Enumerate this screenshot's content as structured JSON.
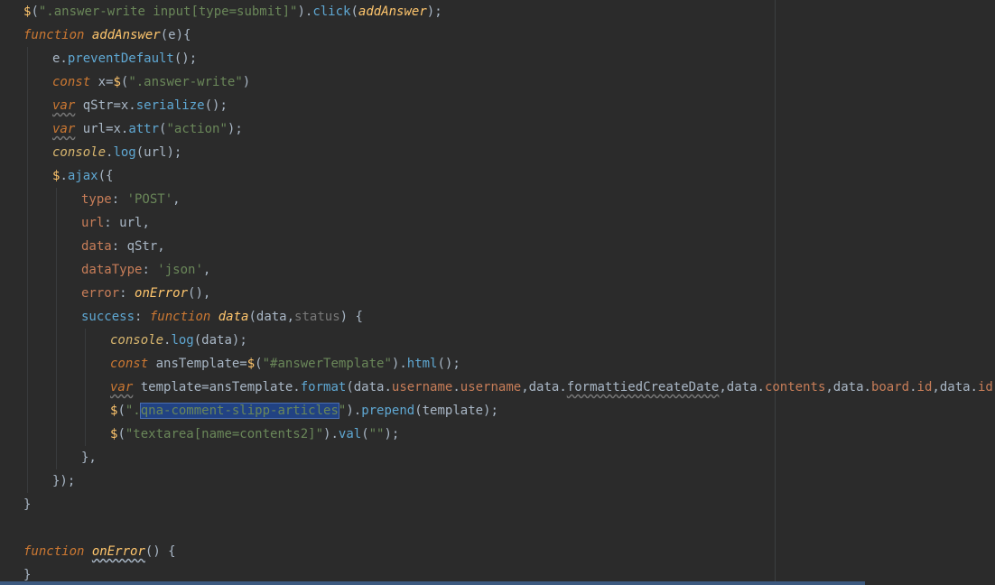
{
  "editor": {
    "lines": [
      {
        "indent": 0,
        "tokens": [
          {
            "c": "t-dollar",
            "t": "$"
          },
          {
            "c": "t-plain",
            "t": "("
          },
          {
            "c": "t-str",
            "t": "\".answer-write input[type=submit]\""
          },
          {
            "c": "t-plain",
            "t": ")."
          },
          {
            "c": "t-method",
            "t": "click"
          },
          {
            "c": "t-plain",
            "t": "("
          },
          {
            "c": "t-fn",
            "t": "addAnswer"
          },
          {
            "c": "t-plain",
            "t": ");"
          }
        ]
      },
      {
        "indent": 0,
        "tokens": [
          {
            "c": "t-kw",
            "t": "function"
          },
          {
            "c": "t-plain",
            "t": " "
          },
          {
            "c": "t-fn",
            "t": "addAnswer"
          },
          {
            "c": "t-plain",
            "t": "(e){"
          }
        ]
      },
      {
        "indent": 1,
        "tokens": [
          {
            "c": "t-plain",
            "t": "e."
          },
          {
            "c": "t-method",
            "t": "preventDefault"
          },
          {
            "c": "t-plain",
            "t": "();"
          }
        ]
      },
      {
        "indent": 1,
        "tokens": [
          {
            "c": "t-kw",
            "t": "const"
          },
          {
            "c": "t-plain",
            "t": " x="
          },
          {
            "c": "t-dollar",
            "t": "$"
          },
          {
            "c": "t-plain",
            "t": "("
          },
          {
            "c": "t-str",
            "t": "\".answer-write\""
          },
          {
            "c": "t-plain",
            "t": ")"
          }
        ]
      },
      {
        "indent": 1,
        "tokens": [
          {
            "c": "t-kw t-wavy",
            "t": "var"
          },
          {
            "c": "t-plain",
            "t": " qStr=x."
          },
          {
            "c": "t-method",
            "t": "serialize"
          },
          {
            "c": "t-plain",
            "t": "();"
          }
        ]
      },
      {
        "indent": 1,
        "tokens": [
          {
            "c": "t-kw t-wavy",
            "t": "var"
          },
          {
            "c": "t-plain",
            "t": " url=x."
          },
          {
            "c": "t-method",
            "t": "attr"
          },
          {
            "c": "t-plain",
            "t": "("
          },
          {
            "c": "t-str",
            "t": "\"action\""
          },
          {
            "c": "t-plain",
            "t": ");"
          }
        ]
      },
      {
        "indent": 1,
        "tokens": [
          {
            "c": "t-console",
            "t": "console"
          },
          {
            "c": "t-plain",
            "t": "."
          },
          {
            "c": "t-method",
            "t": "log"
          },
          {
            "c": "t-plain",
            "t": "(url);"
          }
        ]
      },
      {
        "indent": 1,
        "tokens": [
          {
            "c": "t-dollar",
            "t": "$"
          },
          {
            "c": "t-plain",
            "t": "."
          },
          {
            "c": "t-method",
            "t": "ajax"
          },
          {
            "c": "t-plain",
            "t": "({"
          }
        ]
      },
      {
        "indent": 2,
        "tokens": [
          {
            "c": "t-key",
            "t": "type"
          },
          {
            "c": "t-plain",
            "t": ": "
          },
          {
            "c": "t-str",
            "t": "'POST'"
          },
          {
            "c": "t-plain",
            "t": ","
          }
        ]
      },
      {
        "indent": 2,
        "tokens": [
          {
            "c": "t-key",
            "t": "url"
          },
          {
            "c": "t-plain",
            "t": ": url,"
          }
        ]
      },
      {
        "indent": 2,
        "tokens": [
          {
            "c": "t-key",
            "t": "data"
          },
          {
            "c": "t-plain",
            "t": ": qStr,"
          }
        ]
      },
      {
        "indent": 2,
        "tokens": [
          {
            "c": "t-key",
            "t": "dataType"
          },
          {
            "c": "t-plain",
            "t": ": "
          },
          {
            "c": "t-str",
            "t": "'json'"
          },
          {
            "c": "t-plain",
            "t": ","
          }
        ]
      },
      {
        "indent": 2,
        "tokens": [
          {
            "c": "t-key",
            "t": "error"
          },
          {
            "c": "t-plain",
            "t": ": "
          },
          {
            "c": "t-fn",
            "t": "onError"
          },
          {
            "c": "t-plain",
            "t": "(),"
          }
        ]
      },
      {
        "indent": 2,
        "tokens": [
          {
            "c": "t-method",
            "t": "success"
          },
          {
            "c": "t-plain",
            "t": ": "
          },
          {
            "c": "t-kw",
            "t": "function"
          },
          {
            "c": "t-plain",
            "t": " "
          },
          {
            "c": "t-fn",
            "t": "data"
          },
          {
            "c": "t-plain",
            "t": "(data,"
          },
          {
            "c": "t-gray",
            "t": "status"
          },
          {
            "c": "t-plain",
            "t": ") {"
          }
        ]
      },
      {
        "indent": 3,
        "tokens": [
          {
            "c": "t-console",
            "t": "console"
          },
          {
            "c": "t-plain",
            "t": "."
          },
          {
            "c": "t-method",
            "t": "log"
          },
          {
            "c": "t-plain",
            "t": "(data);"
          }
        ]
      },
      {
        "indent": 3,
        "tokens": [
          {
            "c": "t-kw",
            "t": "const"
          },
          {
            "c": "t-plain",
            "t": " ansTemplate="
          },
          {
            "c": "t-dollar",
            "t": "$"
          },
          {
            "c": "t-plain",
            "t": "("
          },
          {
            "c": "t-str",
            "t": "\"#answerTemplate\""
          },
          {
            "c": "t-plain",
            "t": ")."
          },
          {
            "c": "t-method",
            "t": "html"
          },
          {
            "c": "t-plain",
            "t": "();"
          }
        ]
      },
      {
        "indent": 3,
        "tokens": [
          {
            "c": "t-kw t-wavy",
            "t": "var"
          },
          {
            "c": "t-plain",
            "t": " template=ansTemplate."
          },
          {
            "c": "t-method",
            "t": "format"
          },
          {
            "c": "t-plain",
            "t": "(data."
          },
          {
            "c": "t-prop",
            "t": "username"
          },
          {
            "c": "t-plain",
            "t": "."
          },
          {
            "c": "t-prop",
            "t": "username"
          },
          {
            "c": "t-plain",
            "t": ",data."
          },
          {
            "c": "t-plain t-wavy",
            "t": "formattiedCreateDate"
          },
          {
            "c": "t-plain",
            "t": ",data."
          },
          {
            "c": "t-prop",
            "t": "contents"
          },
          {
            "c": "t-plain",
            "t": ",data."
          },
          {
            "c": "t-prop",
            "t": "board"
          },
          {
            "c": "t-plain",
            "t": "."
          },
          {
            "c": "t-prop",
            "t": "id"
          },
          {
            "c": "t-plain",
            "t": ",data."
          },
          {
            "c": "t-prop",
            "t": "id"
          },
          {
            "c": "t-plain",
            "t": ");"
          }
        ]
      },
      {
        "indent": 3,
        "tokens": [
          {
            "c": "t-dollar",
            "t": "$"
          },
          {
            "c": "t-plain",
            "t": "("
          },
          {
            "c": "t-str",
            "t": "\"."
          },
          {
            "c": "t-str t-sel",
            "t": "qna-comment-slipp-articles"
          },
          {
            "c": "t-str",
            "t": "\""
          },
          {
            "c": "t-plain",
            "t": ")."
          },
          {
            "c": "t-method",
            "t": "prepend"
          },
          {
            "c": "t-plain",
            "t": "(template);"
          }
        ]
      },
      {
        "indent": 3,
        "tokens": [
          {
            "c": "t-dollar",
            "t": "$"
          },
          {
            "c": "t-plain",
            "t": "("
          },
          {
            "c": "t-str",
            "t": "\"textarea[name=contents2]\""
          },
          {
            "c": "t-plain",
            "t": ")."
          },
          {
            "c": "t-method",
            "t": "val"
          },
          {
            "c": "t-plain",
            "t": "("
          },
          {
            "c": "t-str",
            "t": "\"\""
          },
          {
            "c": "t-plain",
            "t": ");"
          }
        ]
      },
      {
        "indent": 2,
        "tokens": [
          {
            "c": "t-plain",
            "t": "},"
          }
        ]
      },
      {
        "indent": 1,
        "tokens": [
          {
            "c": "t-plain",
            "t": "});"
          }
        ]
      },
      {
        "indent": 0,
        "tokens": [
          {
            "c": "t-plain",
            "t": "}"
          }
        ]
      },
      {
        "indent": 0,
        "tokens": []
      },
      {
        "indent": 0,
        "tokens": [
          {
            "c": "t-kw",
            "t": "function"
          },
          {
            "c": "t-plain",
            "t": " "
          },
          {
            "c": "t-fn t-wavy-fn",
            "t": "onError"
          },
          {
            "c": "t-plain",
            "t": "() {"
          }
        ]
      },
      {
        "indent": 0,
        "tokens": [
          {
            "c": "t-plain",
            "t": "}"
          }
        ]
      }
    ]
  }
}
